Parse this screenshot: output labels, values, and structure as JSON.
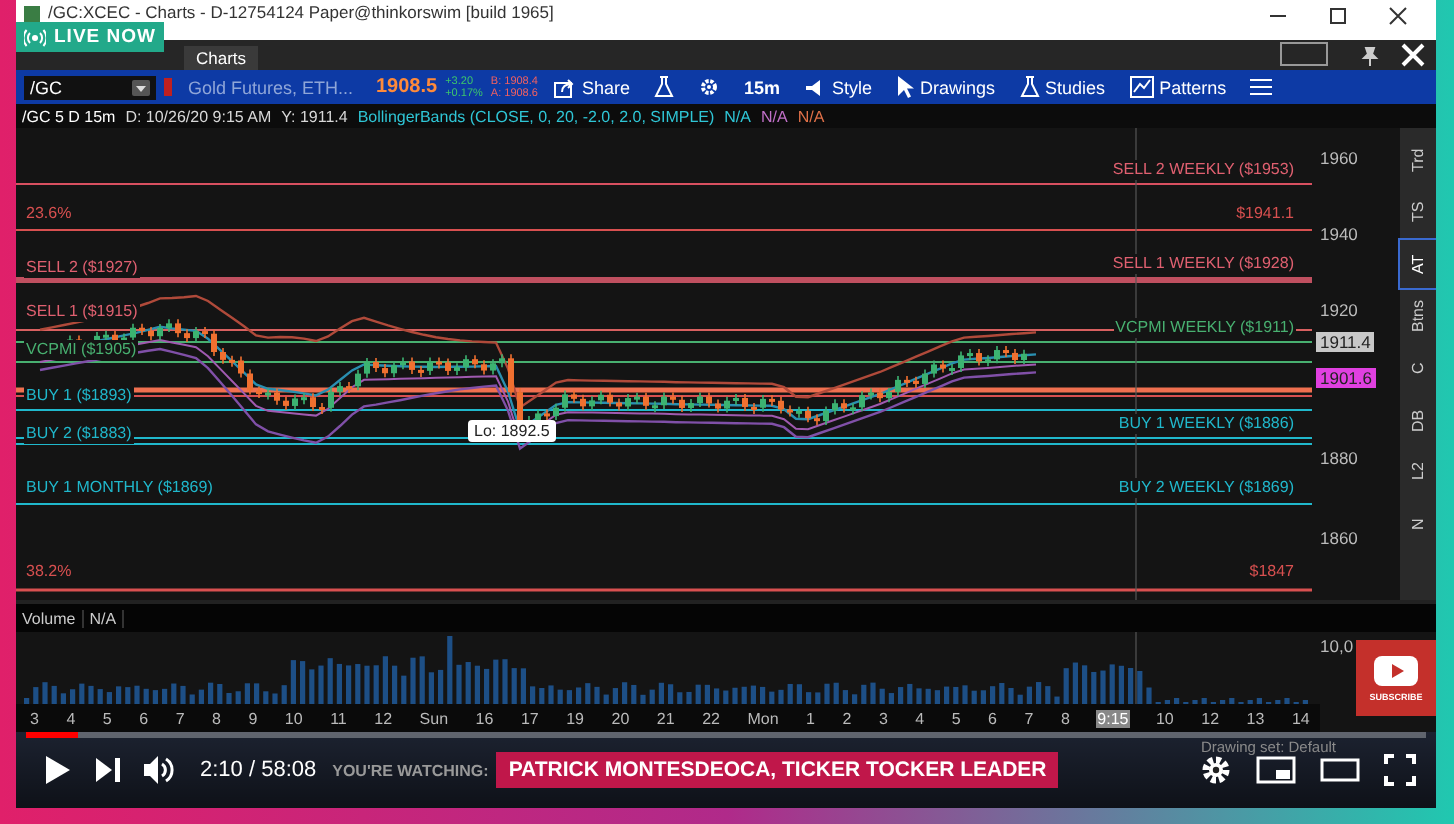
{
  "live_badge": {
    "label": "LIVE NOW"
  },
  "window": {
    "title": "/GC:XCEC - Charts - D-12754124 Paper@thinkorswim [build 1965]"
  },
  "tabs": [
    {
      "label": "Charts",
      "selected": true
    }
  ],
  "toolbar": {
    "symbol": "/GC",
    "description": "Gold Futures, ETH...",
    "last": "1908.5",
    "change": "+3.20",
    "change_pct": "+0.17%",
    "bid": "B: 1908.4",
    "ask": "A: 1908.6",
    "buttons": [
      {
        "kind": "share",
        "label": "Share"
      },
      {
        "kind": "flask"
      },
      {
        "kind": "gear"
      },
      {
        "kind": "text",
        "label": "15m"
      },
      {
        "kind": "style",
        "label": "Style"
      },
      {
        "kind": "cursor",
        "label": "Drawings"
      },
      {
        "kind": "flask",
        "label": "Studies"
      },
      {
        "kind": "patterns",
        "label": "Patterns"
      },
      {
        "kind": "menu"
      }
    ]
  },
  "info": [
    {
      "text": "/GC 5 D 15m",
      "color": "#ffffff"
    },
    {
      "text": "D: 10/26/20 9:15 AM",
      "color": "#d8d8d8"
    },
    {
      "text": "Y: 1911.4",
      "color": "#d8d8d8"
    },
    {
      "text": "BollingerBands (CLOSE, 0, 20, -2.0, 2.0, SIMPLE)",
      "color": "#2fc6d6"
    },
    {
      "text": "N/A",
      "color": "#2fc6d6"
    },
    {
      "text": "N/A",
      "color": "#c070c8"
    },
    {
      "text": "N/A",
      "color": "#e07048"
    }
  ],
  "side_tabs": [
    {
      "label": "Trd",
      "selected": false
    },
    {
      "label": "TS",
      "selected": false
    },
    {
      "label": "AT",
      "selected": true
    },
    {
      "label": "Btns",
      "selected": false
    },
    {
      "label": "C",
      "selected": false
    },
    {
      "label": "DB",
      "selected": false
    },
    {
      "label": "L2",
      "selected": false
    },
    {
      "label": "N",
      "selected": false
    }
  ],
  "chart": {
    "levels_left": [
      {
        "label": "23.6%",
        "kind": "fib"
      },
      {
        "label": "SELL 2 ($1927)",
        "kind": "sell"
      },
      {
        "label": "SELL 1 ($1915)",
        "kind": "sell"
      },
      {
        "label": "VCPMI ($1905)",
        "kind": "pivot"
      },
      {
        "label": "BUY 1 ($1893)",
        "kind": "buy"
      },
      {
        "label": "BUY 2 ($1883)",
        "kind": "buy"
      },
      {
        "label": "BUY 1 MONTHLY ($1869)",
        "kind": "buy"
      },
      {
        "label": "38.2%",
        "kind": "fib"
      }
    ],
    "levels_right": [
      {
        "label": "SELL 2 WEEKLY ($1953)",
        "kind": "sell"
      },
      {
        "label": "$1941.1",
        "kind": "fib"
      },
      {
        "label": "SELL 1 WEEKLY ($1928)",
        "kind": "sell"
      },
      {
        "label": "VCPMI WEEKLY ($1911)",
        "kind": "pivot"
      },
      {
        "label": "BUY 1 WEEKLY ($1886)",
        "kind": "buy"
      },
      {
        "label": "BUY 2 WEEKLY ($1869)",
        "kind": "buy"
      },
      {
        "label": "$1847",
        "kind": "fib"
      }
    ],
    "price_ticks": [
      "1960",
      "1940",
      "1920",
      "1880",
      "1860"
    ],
    "price_badges": [
      {
        "label": "1911.4",
        "color": "#c8c8c8"
      },
      {
        "label": "1901.6",
        "color": "#e040e0"
      }
    ],
    "lo_label": "Lo: 1892.5"
  },
  "volume": {
    "title": "Volume",
    "value": "N/A",
    "scale_label": "10,0"
  },
  "x_axis": [
    {
      "label": "3",
      "highlighted": false
    },
    {
      "label": "4",
      "highlighted": false
    },
    {
      "label": "5",
      "highlighted": false
    },
    {
      "label": "6",
      "highlighted": false
    },
    {
      "label": "7",
      "highlighted": false
    },
    {
      "label": "8",
      "highlighted": false
    },
    {
      "label": "9",
      "highlighted": false
    },
    {
      "label": "10",
      "highlighted": false
    },
    {
      "label": "11",
      "highlighted": false
    },
    {
      "label": "12",
      "highlighted": false
    },
    {
      "label": "Sun",
      "highlighted": false
    },
    {
      "label": "16",
      "highlighted": false
    },
    {
      "label": "17",
      "highlighted": false
    },
    {
      "label": "19",
      "highlighted": false
    },
    {
      "label": "20",
      "highlighted": false
    },
    {
      "label": "21",
      "highlighted": false
    },
    {
      "label": "22",
      "highlighted": false
    },
    {
      "label": "Mon",
      "highlighted": false
    },
    {
      "label": "1",
      "highlighted": false
    },
    {
      "label": "2",
      "highlighted": false
    },
    {
      "label": "3",
      "highlighted": false
    },
    {
      "label": "4",
      "highlighted": false
    },
    {
      "label": "5",
      "highlighted": false
    },
    {
      "label": "6",
      "highlighted": false
    },
    {
      "label": "7",
      "highlighted": false
    },
    {
      "label": "8",
      "highlighted": false
    },
    {
      "label": "9:15",
      "highlighted": true
    },
    {
      "label": "10",
      "highlighted": false
    },
    {
      "label": "12",
      "highlighted": false
    },
    {
      "label": "13",
      "highlighted": false
    },
    {
      "label": "14",
      "highlighted": false
    }
  ],
  "drawing_set": "Drawing set: Default",
  "player": {
    "progress": {
      "level": 0.037
    },
    "time": "2:10 / 58:08",
    "watching": "YOU'RE WATCHING:",
    "banner": "PATRICK MONTESDEOCA, TICKER TOCKER LEADER",
    "subscribe": "SUBSCRIBE"
  }
}
